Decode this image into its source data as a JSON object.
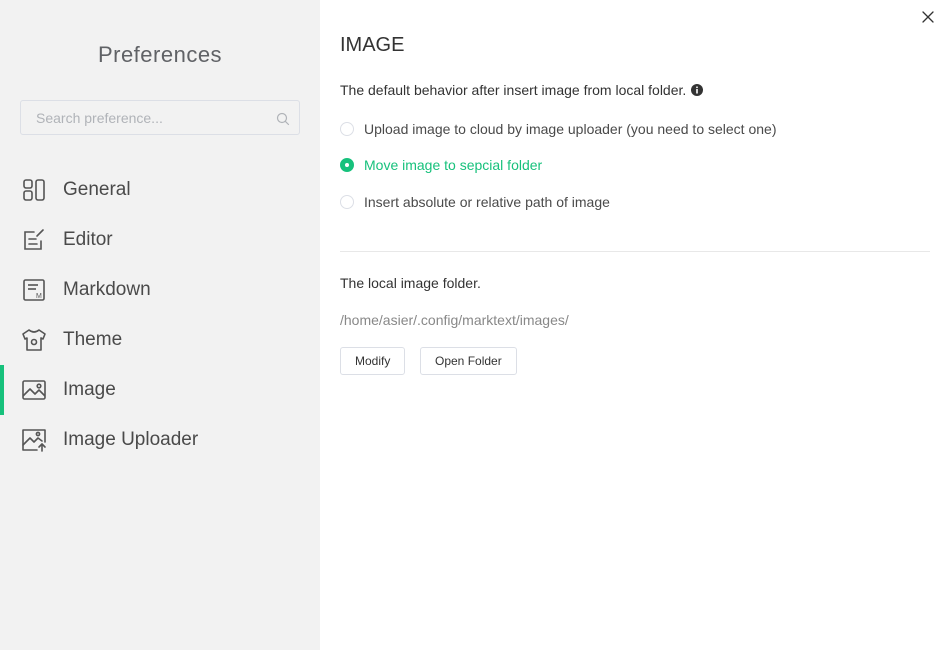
{
  "sidebar": {
    "title": "Preferences",
    "search": {
      "placeholder": "Search preference...",
      "value": ""
    },
    "items": [
      {
        "label": "General",
        "icon": "general-icon",
        "active": false
      },
      {
        "label": "Editor",
        "icon": "editor-icon",
        "active": false
      },
      {
        "label": "Markdown",
        "icon": "markdown-icon",
        "active": false
      },
      {
        "label": "Theme",
        "icon": "theme-icon",
        "active": false
      },
      {
        "label": "Image",
        "icon": "image-icon",
        "active": true
      },
      {
        "label": "Image Uploader",
        "icon": "image-uploader-icon",
        "active": false
      }
    ]
  },
  "main": {
    "title": "IMAGE",
    "insert_behavior": {
      "description": "The default behavior after insert image from local folder.",
      "options": [
        {
          "label": "Upload image to cloud by image uploader (you need to select one)",
          "checked": false
        },
        {
          "label": "Move image to sepcial folder",
          "checked": true
        },
        {
          "label": "Insert absolute or relative path of image",
          "checked": false
        }
      ]
    },
    "local_folder": {
      "description": "The local image folder.",
      "path": "/home/asier/.config/marktext/images/",
      "modify_label": "Modify",
      "open_folder_label": "Open Folder"
    }
  },
  "colors": {
    "accent": "#17c17c",
    "sidebar_bg": "#f2f2f2",
    "text": "#333333"
  }
}
